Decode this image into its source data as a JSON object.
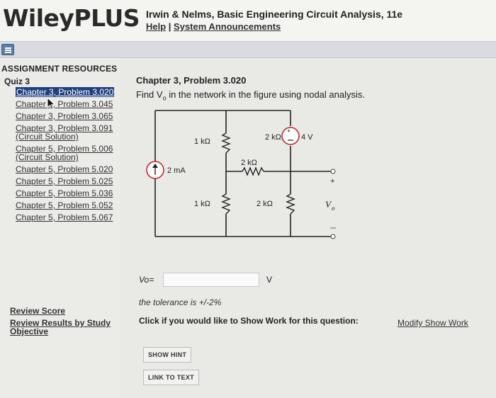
{
  "header": {
    "logo": "WileyPLUS",
    "book_title": "Irwin & Nelms, Basic Engineering Circuit Analysis, 11e",
    "help_link": "Help",
    "separator": " | ",
    "announcements_link": "System Announcements"
  },
  "sidebar": {
    "heading": "ASSIGNMENT RESOURCES",
    "quiz_label": "Quiz 3",
    "problems": [
      {
        "label": "Chapter 3, Problem 3.020",
        "active": true
      },
      {
        "label": "Chapter 3, Problem 3.045",
        "active": false
      },
      {
        "label": "Chapter 3, Problem 3.065",
        "active": false
      },
      {
        "label": "Chapter 3, Problem 3.091 (Circuit Solution)",
        "active": false
      },
      {
        "label": "Chapter 5, Problem 5.006 (Circuit Solution)",
        "active": false
      },
      {
        "label": "Chapter 5, Problem 5.020",
        "active": false
      },
      {
        "label": "Chapter 5, Problem 5.025",
        "active": false
      },
      {
        "label": "Chapter 5, Problem 5.036",
        "active": false
      },
      {
        "label": "Chapter 5, Problem 5.052",
        "active": false
      },
      {
        "label": "Chapter 5, Problem 5.067",
        "active": false
      }
    ],
    "review_score": "Review Score",
    "review_objective": "Review Results by Study Objective"
  },
  "main": {
    "problem_title": "Chapter 3, Problem 3.020",
    "prompt_prefix": "Find V",
    "prompt_sub": "o",
    "prompt_suffix": " in the network in the figure using nodal analysis.",
    "circuit": {
      "r1": "1 kΩ",
      "r2": "2 kΩ",
      "r3": "1 kΩ",
      "r4": "2 kΩ",
      "source_current": "2 mA",
      "source_voltage": "4 V",
      "plus_sign": "+",
      "output_label": "V",
      "output_sub": "o"
    },
    "answer": {
      "label": "Vo=",
      "value": "",
      "unit": "V"
    },
    "tolerance": "the tolerance is +/-2%",
    "show_work_text": "Click if you would like to Show Work for this question:",
    "modify_link": "Modify Show Work",
    "hint_button": "SHOW HINT",
    "link_text_button": "LINK TO TEXT"
  },
  "colors": {
    "header_bg": "#f4f4f1",
    "toolbar_bg": "#d9dbe0",
    "active_item_bg": "#1f3f80",
    "source_red": "#c62828",
    "page_bg": "#e9e9e6"
  }
}
